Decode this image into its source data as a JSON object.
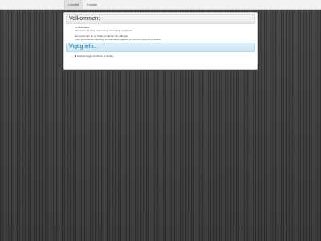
{
  "nav": {
    "items": [
      {
        "label": "Lokalité"
      },
      {
        "label": "Forside"
      }
    ]
  },
  "welcome": {
    "title": "Velkommen:",
    "lines": [
      "Et udsættelse.",
      "Med fokus på alting med mange forskellige muligheder.",
      "Her under kan du se hvilke produkter der udbydes.",
      "Viser (kommende udstilling) Du kan da se opgaver et hvidt kort fører til på et sted."
    ]
  },
  "info": {
    "title": "Vigtig info...",
    "items": [
      "Husk at logge ud når du er færdig."
    ]
  }
}
